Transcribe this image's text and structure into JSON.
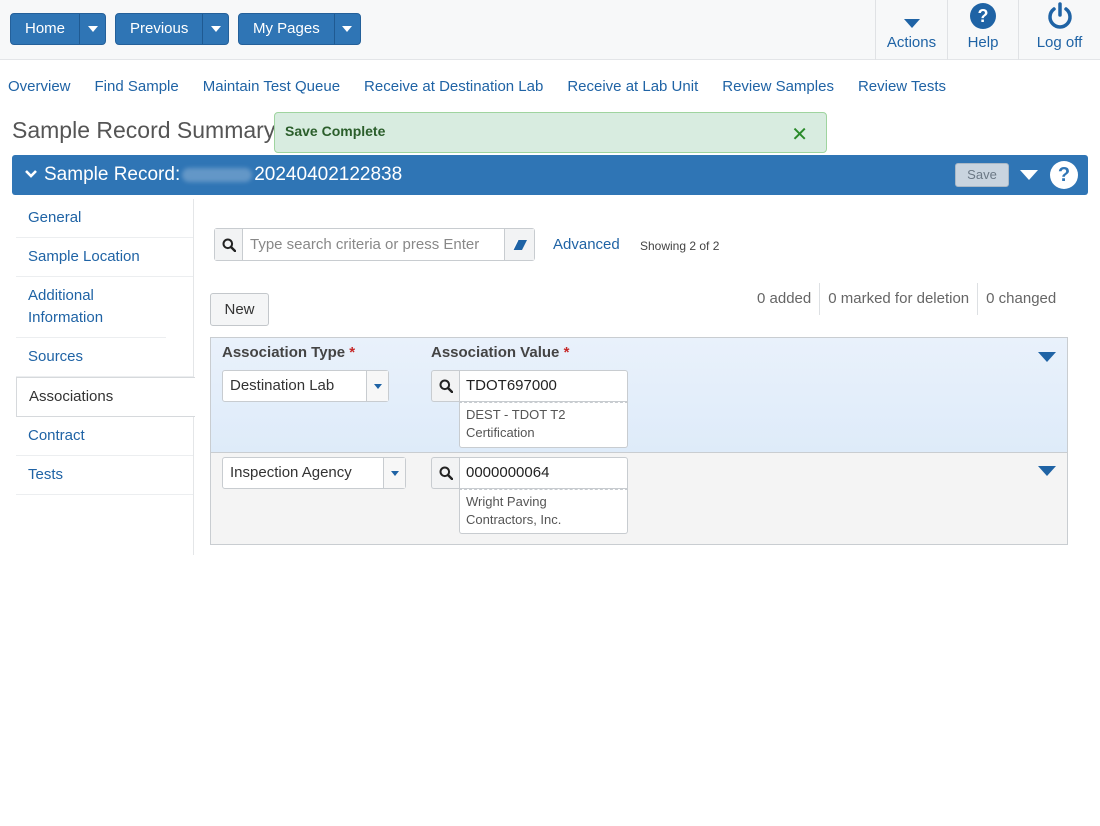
{
  "topbar": {
    "nav_buttons": [
      {
        "label": "Home"
      },
      {
        "label": "Previous"
      },
      {
        "label": "My Pages"
      }
    ],
    "actions": [
      {
        "label": "Actions",
        "icon": "caret-down-icon"
      },
      {
        "label": "Help",
        "icon": "question-circle-icon"
      },
      {
        "label": "Log off",
        "icon": "power-icon"
      }
    ]
  },
  "subnav": [
    "Overview",
    "Find Sample",
    "Maintain Test Queue",
    "Receive at Destination Lab",
    "Receive at Lab Unit",
    "Review Samples",
    "Review Tests"
  ],
  "page_title": "Sample Record Summary",
  "toast": {
    "message": "Save Complete",
    "close": "✕"
  },
  "record": {
    "label": "Sample Record:",
    "number": "20240402122838",
    "save_label": "Save",
    "help": "?"
  },
  "sidenav": [
    {
      "label": "General"
    },
    {
      "label": "Sample Location"
    },
    {
      "label": "Additional Information"
    },
    {
      "label": "Sources"
    },
    {
      "label": "Associations",
      "active": true
    },
    {
      "label": "Contract"
    },
    {
      "label": "Tests"
    }
  ],
  "search": {
    "placeholder": "Type search criteria or press Enter",
    "advanced_label": "Advanced",
    "showing": "Showing 2 of 2"
  },
  "new_label": "New",
  "stats": {
    "added": "0 added",
    "deleted": "0 marked for deletion",
    "changed": "0 changed"
  },
  "grid": {
    "headers": {
      "type": "Association Type",
      "value": "Association Value",
      "required": "*"
    },
    "rows": [
      {
        "type": "Destination Lab",
        "value": "TDOT697000",
        "desc": "DEST - TDOT T2 Certification"
      },
      {
        "type": "Inspection Agency",
        "value": "0000000064",
        "desc": "Wright Paving Contractors, Inc."
      }
    ]
  },
  "colors": {
    "primary": "#2f75b5",
    "link": "#1f63a5",
    "success_bg": "#d8ece0"
  }
}
